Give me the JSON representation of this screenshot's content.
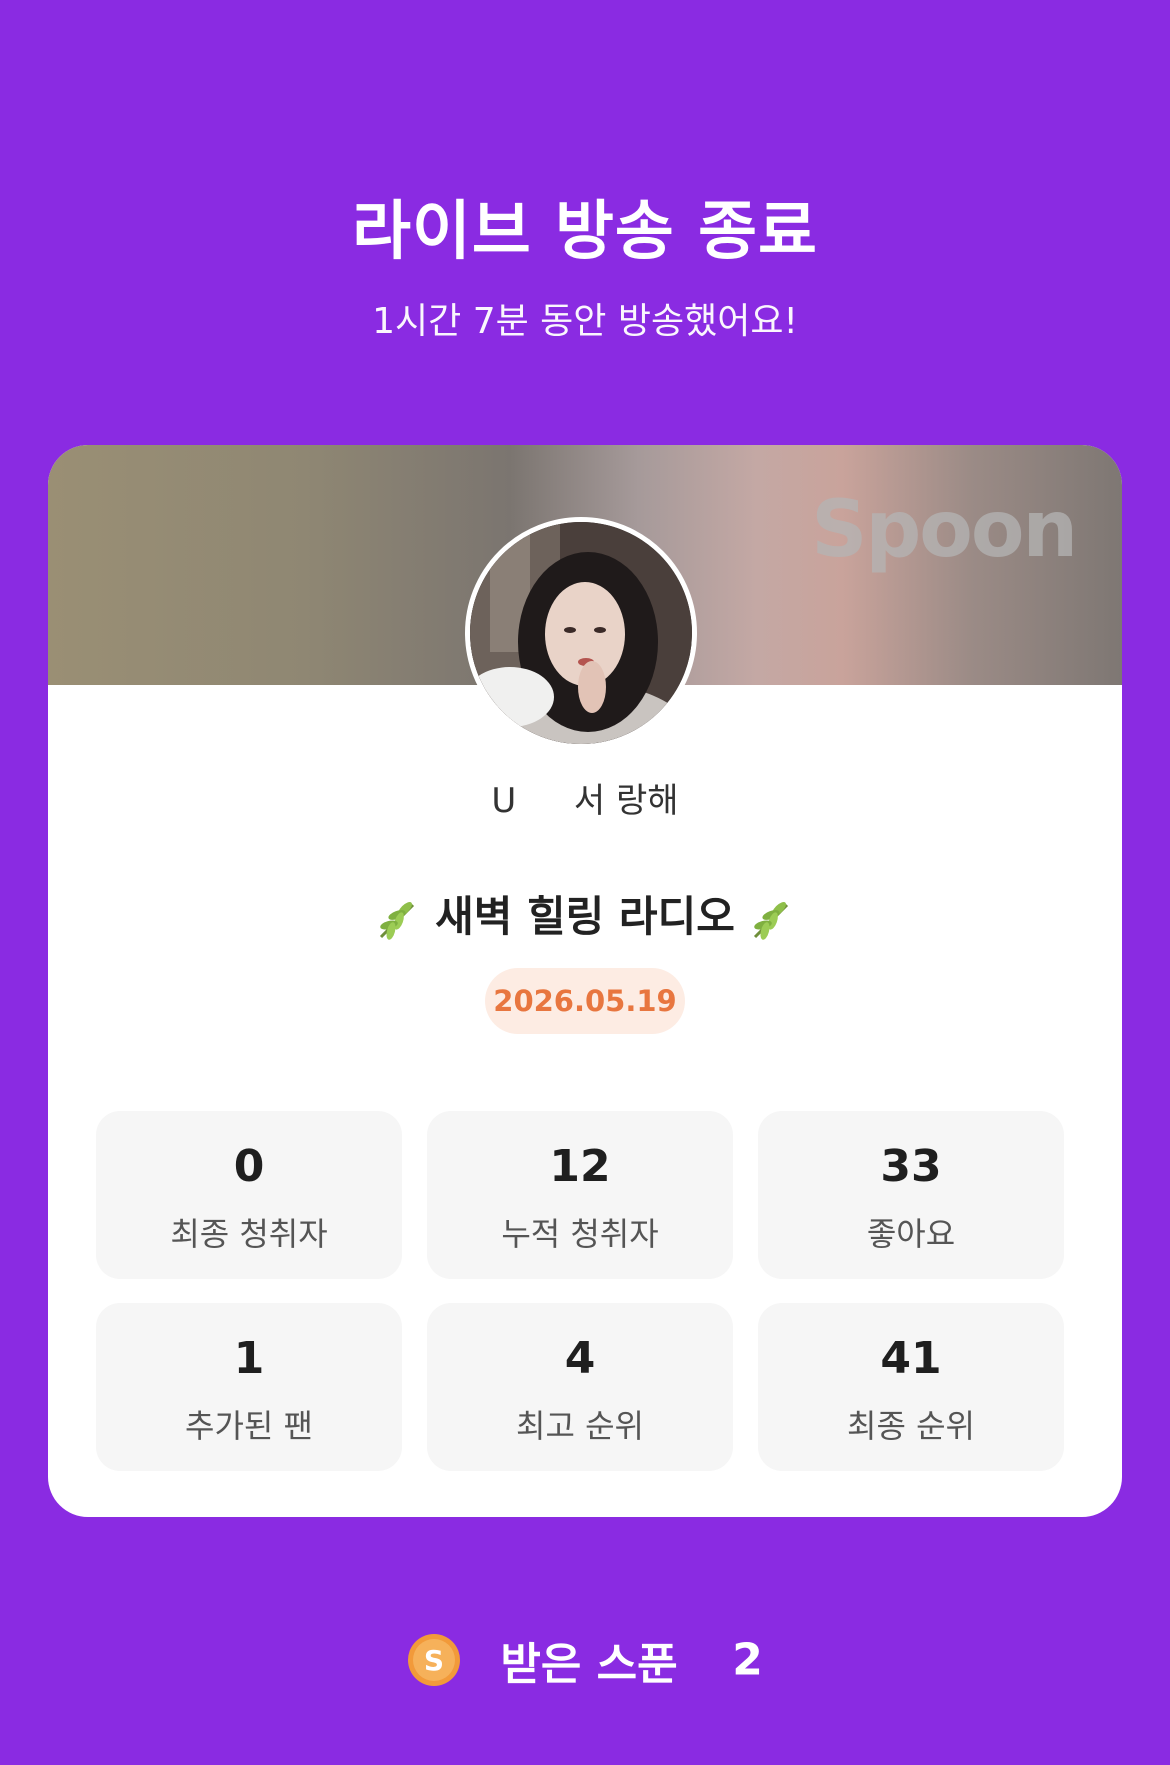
{
  "header": {
    "title": "라이브 방송 종료",
    "subtitle": "1시간 7분 동안 방송했어요!"
  },
  "card": {
    "banner_logo": "Spoon",
    "username_prefix": "U",
    "username": "서 랑해",
    "live_title": "새벽 힐링 라디오",
    "date": "2026.05.19",
    "stats": [
      {
        "value": "0",
        "label": "최종 청취자"
      },
      {
        "value": "12",
        "label": "누적 청취자"
      },
      {
        "value": "33",
        "label": "좋아요"
      },
      {
        "value": "1",
        "label": "추가된 팬"
      },
      {
        "value": "4",
        "label": "최고 순위"
      },
      {
        "value": "41",
        "label": "최종 순위"
      }
    ]
  },
  "footer": {
    "spoon_label": "받은 스푼",
    "spoon_count": "2"
  },
  "colors": {
    "background": "#8a2be2",
    "date_text": "#e8763f",
    "date_bg": "#fdece3",
    "coin": "#f29a3a"
  }
}
